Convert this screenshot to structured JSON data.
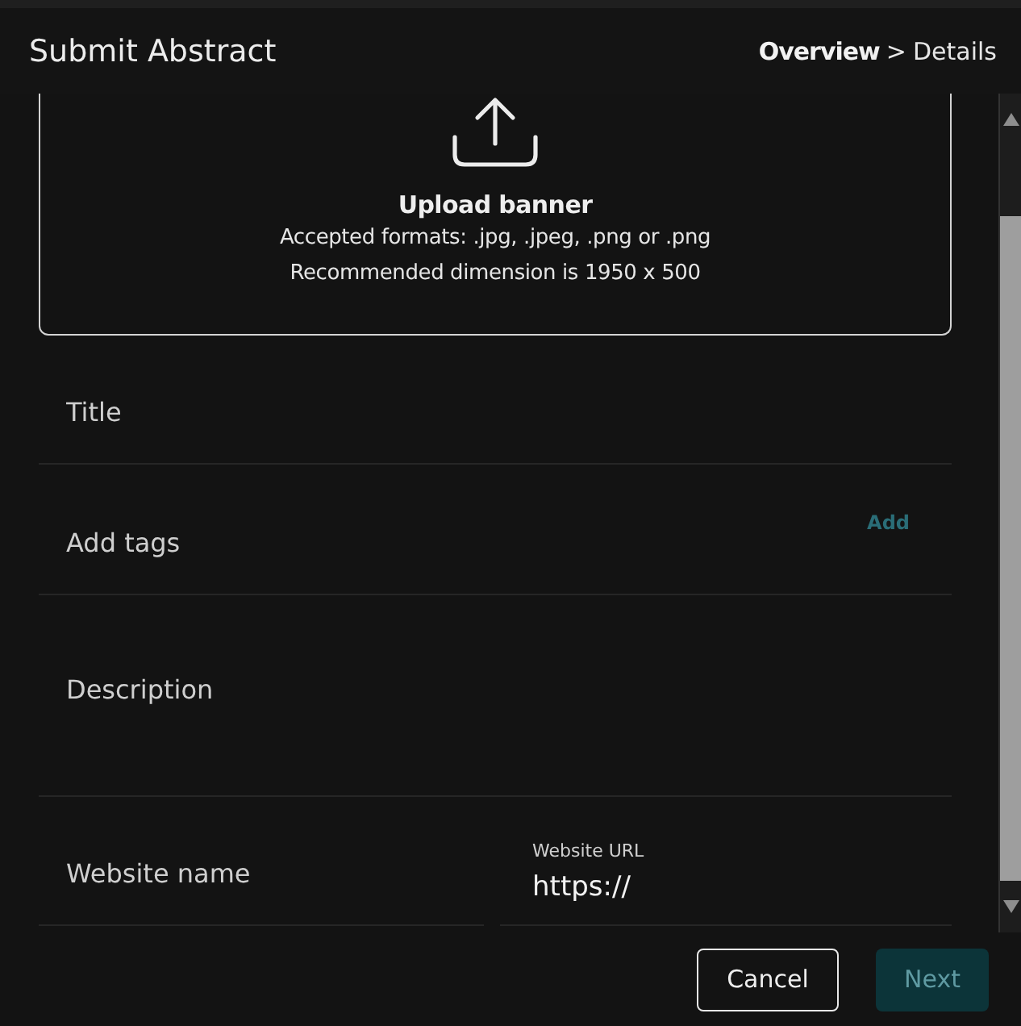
{
  "header": {
    "title": "Submit Abstract",
    "breadcrumb": {
      "items": [
        {
          "label": "Overview",
          "selected": true
        },
        {
          "label": "Details",
          "selected": false
        }
      ],
      "separator": ">"
    }
  },
  "upload": {
    "title": "Upload banner",
    "lines": [
      "Accepted formats: .jpg, .jpeg, .png or .png",
      "Recommended dimension is 1950 x 500"
    ]
  },
  "form": {
    "rows": [
      {
        "fields": [
          {
            "kind": "input",
            "placeholder": "Title"
          }
        ]
      },
      {
        "fields": [
          {
            "kind": "tags",
            "placeholder": "Add tags",
            "action": {
              "label": "Add",
              "disabled": true
            }
          }
        ]
      },
      {
        "fields": [
          {
            "kind": "textarea",
            "placeholder": "Description"
          }
        ]
      },
      {
        "fields": [
          {
            "kind": "input",
            "placeholder": "Website name"
          },
          {
            "kind": "url",
            "label": "Website URL",
            "value": "https://"
          }
        ]
      }
    ]
  },
  "footer": {
    "buttons": [
      {
        "label": "Cancel",
        "kind": "secondary",
        "disabled": false
      },
      {
        "label": "Next",
        "kind": "primary",
        "disabled": true
      }
    ]
  }
}
